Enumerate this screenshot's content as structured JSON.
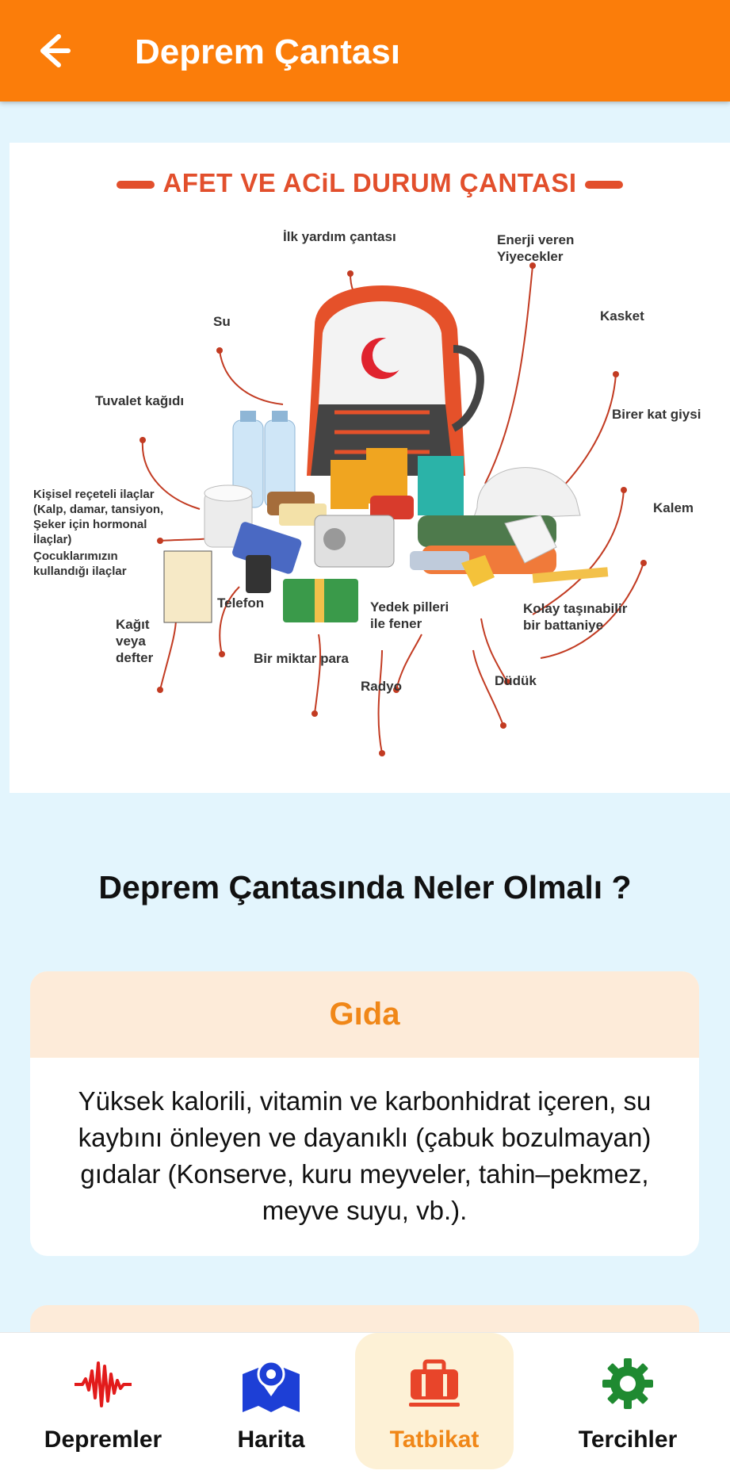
{
  "appbar": {
    "title": "Deprem Çantası"
  },
  "infographic": {
    "title": "AFET VE ACiL DURUM ÇANTASI",
    "labels": {
      "first_aid": "İlk yardım çantası",
      "energy_food": "Enerji veren\nYiyecekler",
      "water": "Su",
      "cap": "Kasket",
      "toilet_paper": "Tuvalet kağıdı",
      "clothes": "Birer kat giysi",
      "medicine": "Kişisel reçeteli ilaçlar\n(Kalp, damar, tansiyon,\nŞeker için hormonal\nİlaçlar)",
      "pen": "Kalem",
      "child_medicine": "Çocuklarımızın\nkullandığı ilaçlar",
      "phone": "Telefon",
      "batteries": "Yedek pilleri\nile fener",
      "blanket": "Kolay taşınabilir\nbir battaniye",
      "notebook": "Kağıt\nveya\ndefter",
      "money": "Bir miktar para",
      "whistle": "Düdük",
      "radio": "Radyo"
    }
  },
  "heading": "Deprem Çantasında Neler Olmalı ?",
  "cards": [
    {
      "title": "Gıda",
      "body": "Yüksek kalorili, vitamin ve karbonhidrat içeren, su kaybını önleyen ve dayanıklı (çabuk bozulmayan) gıdalar (Konserve, kuru meyveler, tahin–pekmez, meyve suyu, vb.)."
    },
    {
      "title": "",
      "body": ""
    }
  ],
  "bottom_nav": [
    {
      "label": "Depremler",
      "icon": "seismograph-icon",
      "active": false
    },
    {
      "label": "Harita",
      "icon": "map-pin-icon",
      "active": false
    },
    {
      "label": "Tatbikat",
      "icon": "briefcase-icon",
      "active": true
    },
    {
      "label": "Tercihler",
      "icon": "gear-icon",
      "active": false
    }
  ],
  "colors": {
    "accent": "#fb7d0a",
    "active_label": "#f08718",
    "background": "#e3f5fd",
    "card_header": "#fdebd9",
    "map_blue": "#1d3fd6",
    "wave_red": "#e21b1b",
    "gear_green": "#1f8a31"
  }
}
